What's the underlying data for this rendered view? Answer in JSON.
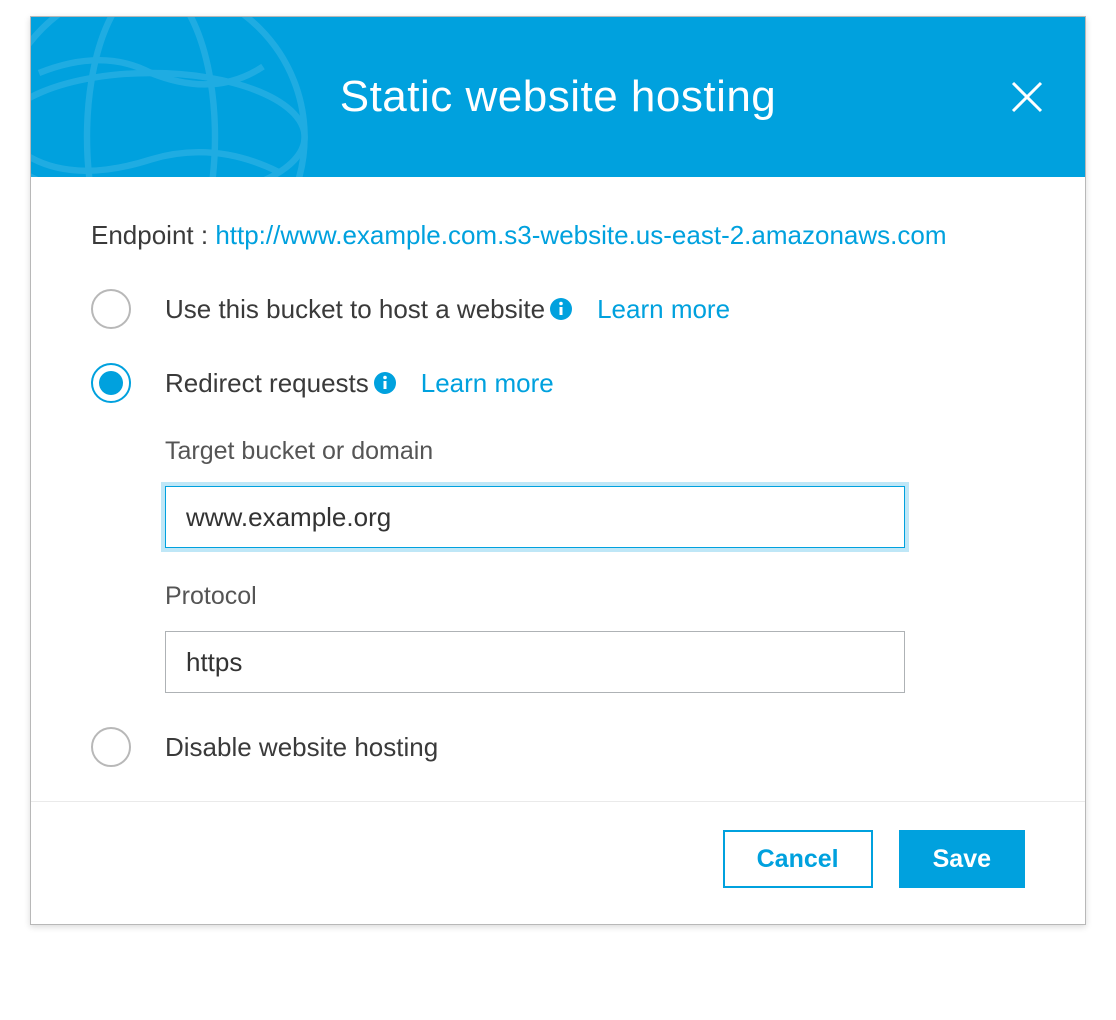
{
  "header": {
    "title": "Static website hosting"
  },
  "endpoint": {
    "label": "Endpoint : ",
    "url": "http://www.example.com.s3-website.us-east-2.amazonaws.com"
  },
  "options": {
    "host": {
      "label": "Use this bucket to host a website",
      "learn_more": "Learn more",
      "selected": false
    },
    "redirect": {
      "label": "Redirect requests",
      "learn_more": "Learn more",
      "selected": true
    },
    "disable": {
      "label": "Disable website hosting",
      "selected": false
    }
  },
  "redirect_config": {
    "target_label": "Target bucket or domain",
    "target_value": "www.example.org",
    "protocol_label": "Protocol",
    "protocol_value": "https"
  },
  "footer": {
    "cancel": "Cancel",
    "save": "Save"
  },
  "colors": {
    "accent": "#00a1de"
  }
}
